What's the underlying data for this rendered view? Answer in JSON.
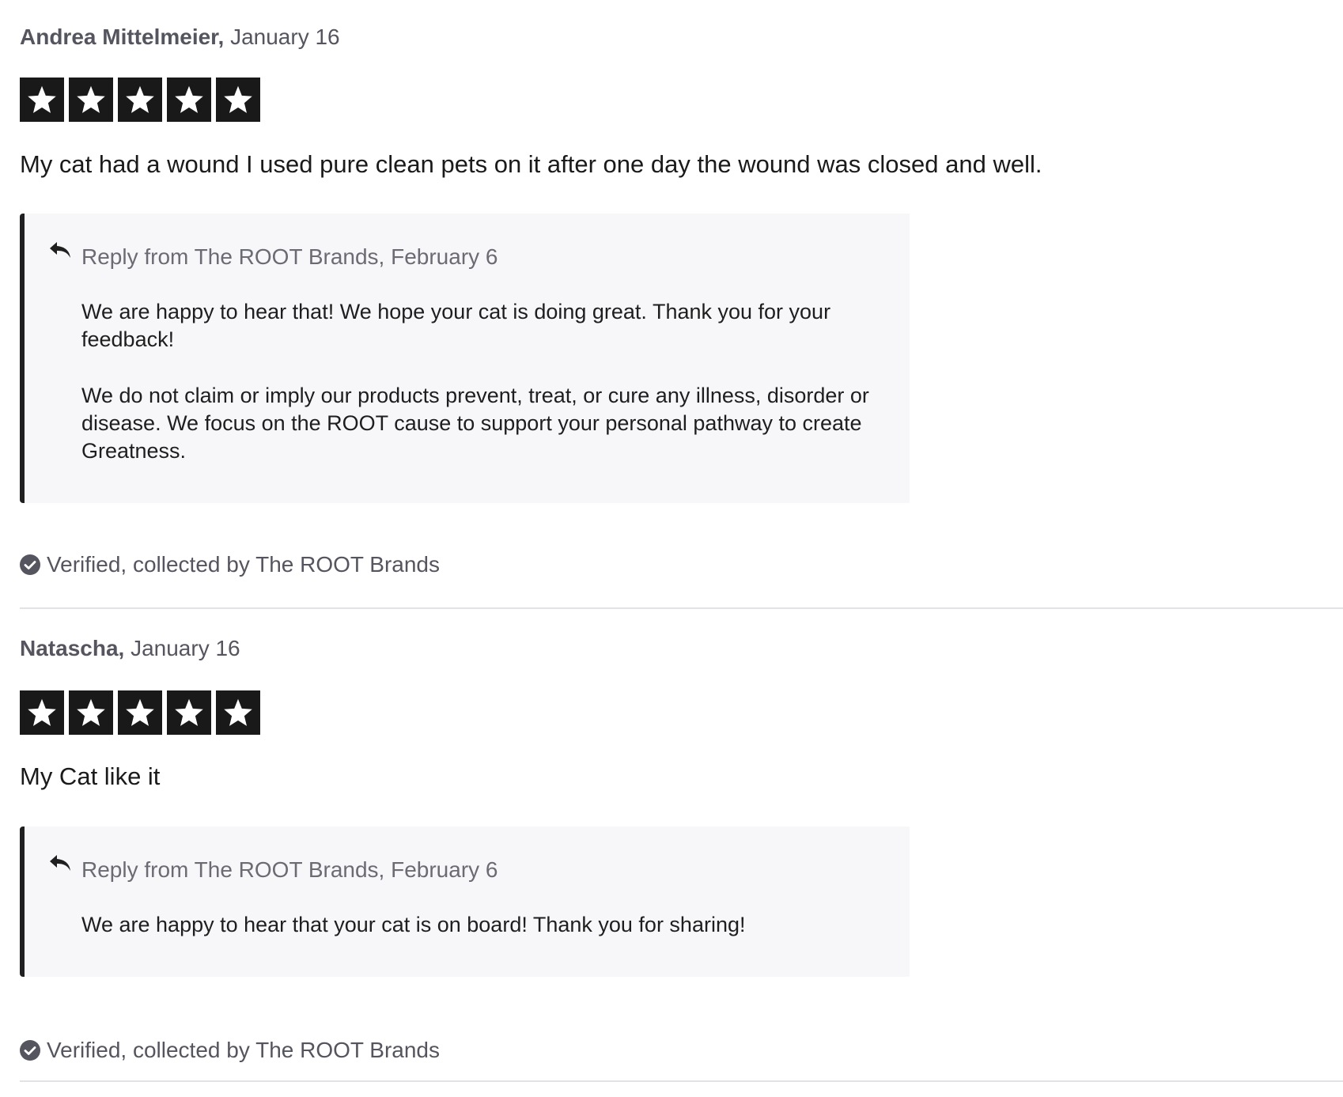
{
  "reviews": [
    {
      "name": "Andrea Mittelmeier,",
      "date": " January 16",
      "rating": 5,
      "text": "My cat had a wound I used pure clean pets on it after one day the wound was closed and well.",
      "reply": {
        "prefix": "Reply from ",
        "company": "The ROOT Brands,",
        "date": " February 6",
        "paragraphs": [
          "We are happy to hear that! We hope your cat is doing great. Thank you for your feedback!",
          "We do not claim or imply our products prevent, treat, or cure any illness, disorder or disease. We focus on the ROOT cause to support your personal pathway to create Greatness."
        ]
      },
      "verified": "Verified, collected by The ROOT Brands"
    },
    {
      "name": "Natascha,",
      "date": " January 16",
      "rating": 5,
      "text": "My Cat like it",
      "reply": {
        "prefix": "Reply from ",
        "company": "The ROOT Brands,",
        "date": " February 6",
        "paragraphs": [
          "We are happy to hear that your cat is on board! Thank you for sharing!"
        ]
      },
      "verified": "Verified, collected by The ROOT Brands"
    }
  ],
  "icons": {
    "star": "star-icon",
    "reply": "reply-arrow-icon",
    "verified": "checkmark-circle-icon"
  },
  "colors": {
    "star_background": "#191919",
    "reply_background": "#f7f7fa",
    "reply_border": "#1f1f1f",
    "divider": "#e2e2e6",
    "muted_text": "#55555f"
  }
}
